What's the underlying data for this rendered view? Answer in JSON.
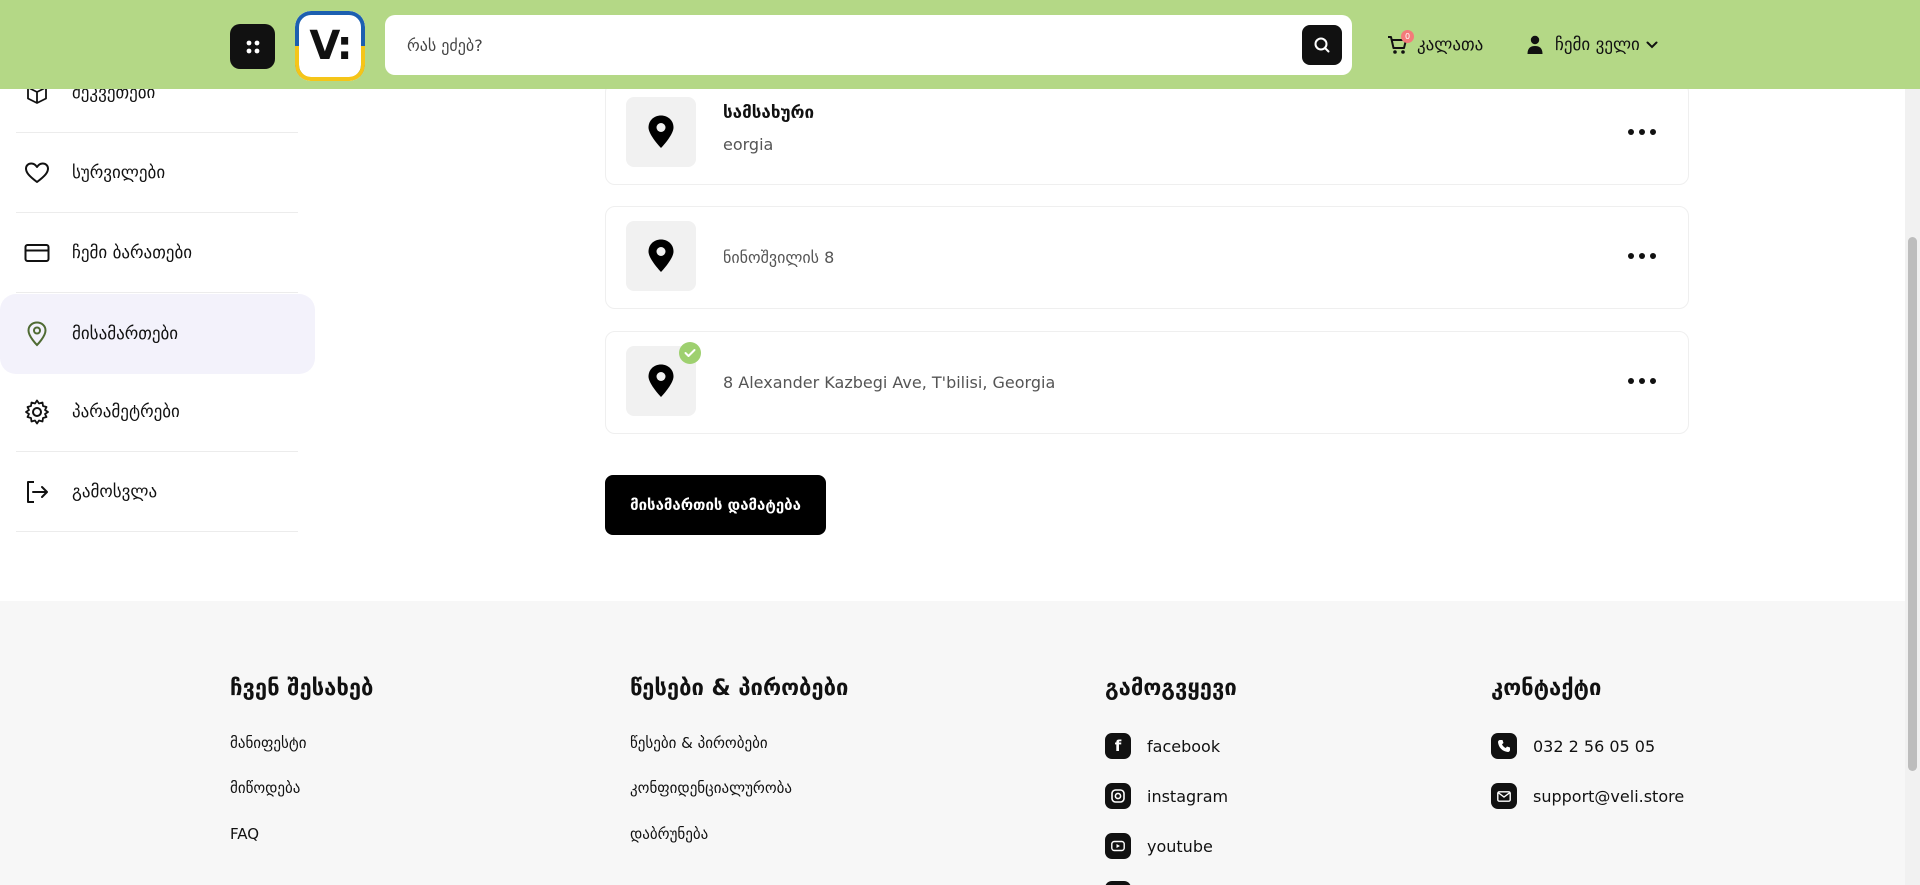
{
  "header": {
    "search_placeholder": "რას ეძებ?",
    "cart_label": "კალათა",
    "cart_count": "0",
    "account_label": "ჩემი ველი",
    "logo_text": "V:"
  },
  "sidebar": {
    "items": [
      {
        "label": "შეკვეთები",
        "icon": "box-icon"
      },
      {
        "label": "სურვილები",
        "icon": "heart-icon"
      },
      {
        "label": "ჩემი ბარათები",
        "icon": "card-icon"
      },
      {
        "label": "მისამართები",
        "icon": "location-pin-icon",
        "active": true
      },
      {
        "label": "პარამეტრები",
        "icon": "gear-icon"
      },
      {
        "label": "გამოსვლა",
        "icon": "logout-icon"
      }
    ]
  },
  "addresses": [
    {
      "title": "სამსახური",
      "subtitle": "eorgia",
      "default": false
    },
    {
      "title": "",
      "subtitle": "ნინოშვილის 8",
      "default": false
    },
    {
      "title": "",
      "subtitle": "8 Alexander Kazbegi Ave, T'bilisi, Georgia",
      "default": true
    }
  ],
  "add_address_label": "მისამართის დამატება",
  "footer": {
    "about": {
      "title": "ჩვენ შესახებ",
      "links": [
        "მანიფესტი",
        "მიწოდება",
        "FAQ"
      ]
    },
    "terms": {
      "title": "წესები & პირობები",
      "links": [
        "წესები & პირობები",
        "კონფიდენციალურობა",
        "დაბრუნება"
      ]
    },
    "follow": {
      "title": "გამოგვყევი",
      "links": [
        "facebook",
        "instagram",
        "youtube"
      ]
    },
    "contact": {
      "title": "კონტაქტი",
      "phone": "032 2 56 05 05",
      "email": "support@veli.store"
    }
  },
  "colors": {
    "header_bg": "#b4d886",
    "accent_check": "#9ed06f",
    "active_nav_bg": "#f3f2fb",
    "badge": "#f47a7a"
  }
}
